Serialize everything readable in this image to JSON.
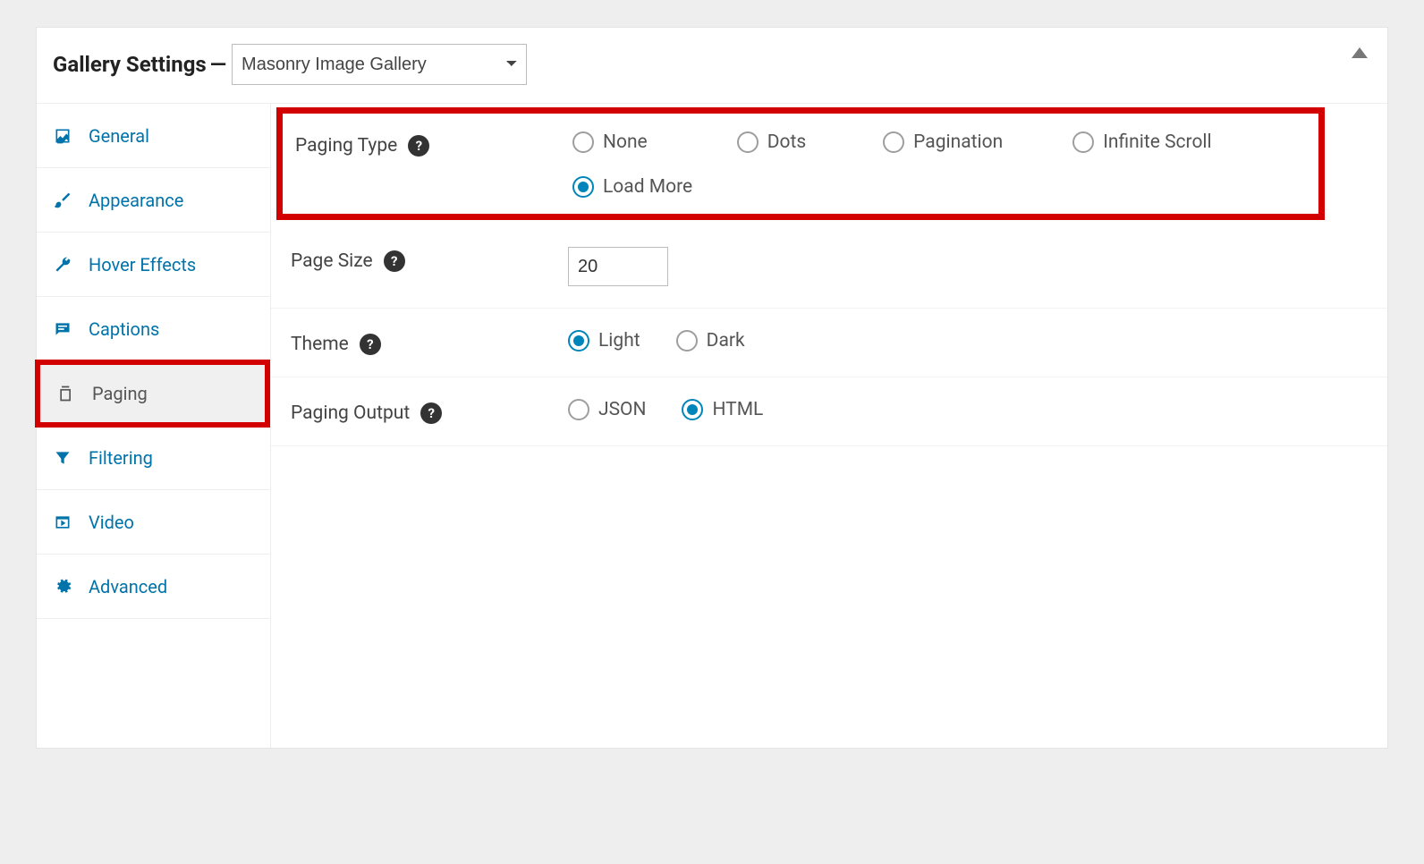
{
  "header": {
    "title": "Gallery Settings",
    "dash": "—",
    "gallery_select": "Masonry Image Gallery"
  },
  "sidebar": {
    "items": [
      {
        "label": "General"
      },
      {
        "label": "Appearance"
      },
      {
        "label": "Hover Effects"
      },
      {
        "label": "Captions"
      },
      {
        "label": "Paging"
      },
      {
        "label": "Filtering"
      },
      {
        "label": "Video"
      },
      {
        "label": "Advanced"
      }
    ]
  },
  "rows": {
    "paging_type": {
      "label": "Paging Type",
      "options": [
        "None",
        "Dots",
        "Pagination",
        "Infinite Scroll",
        "Load More"
      ],
      "selected": "Load More"
    },
    "page_size": {
      "label": "Page Size",
      "value": "20"
    },
    "theme": {
      "label": "Theme",
      "options": [
        "Light",
        "Dark"
      ],
      "selected": "Light"
    },
    "paging_output": {
      "label": "Paging Output",
      "options": [
        "JSON",
        "HTML"
      ],
      "selected": "HTML"
    }
  }
}
